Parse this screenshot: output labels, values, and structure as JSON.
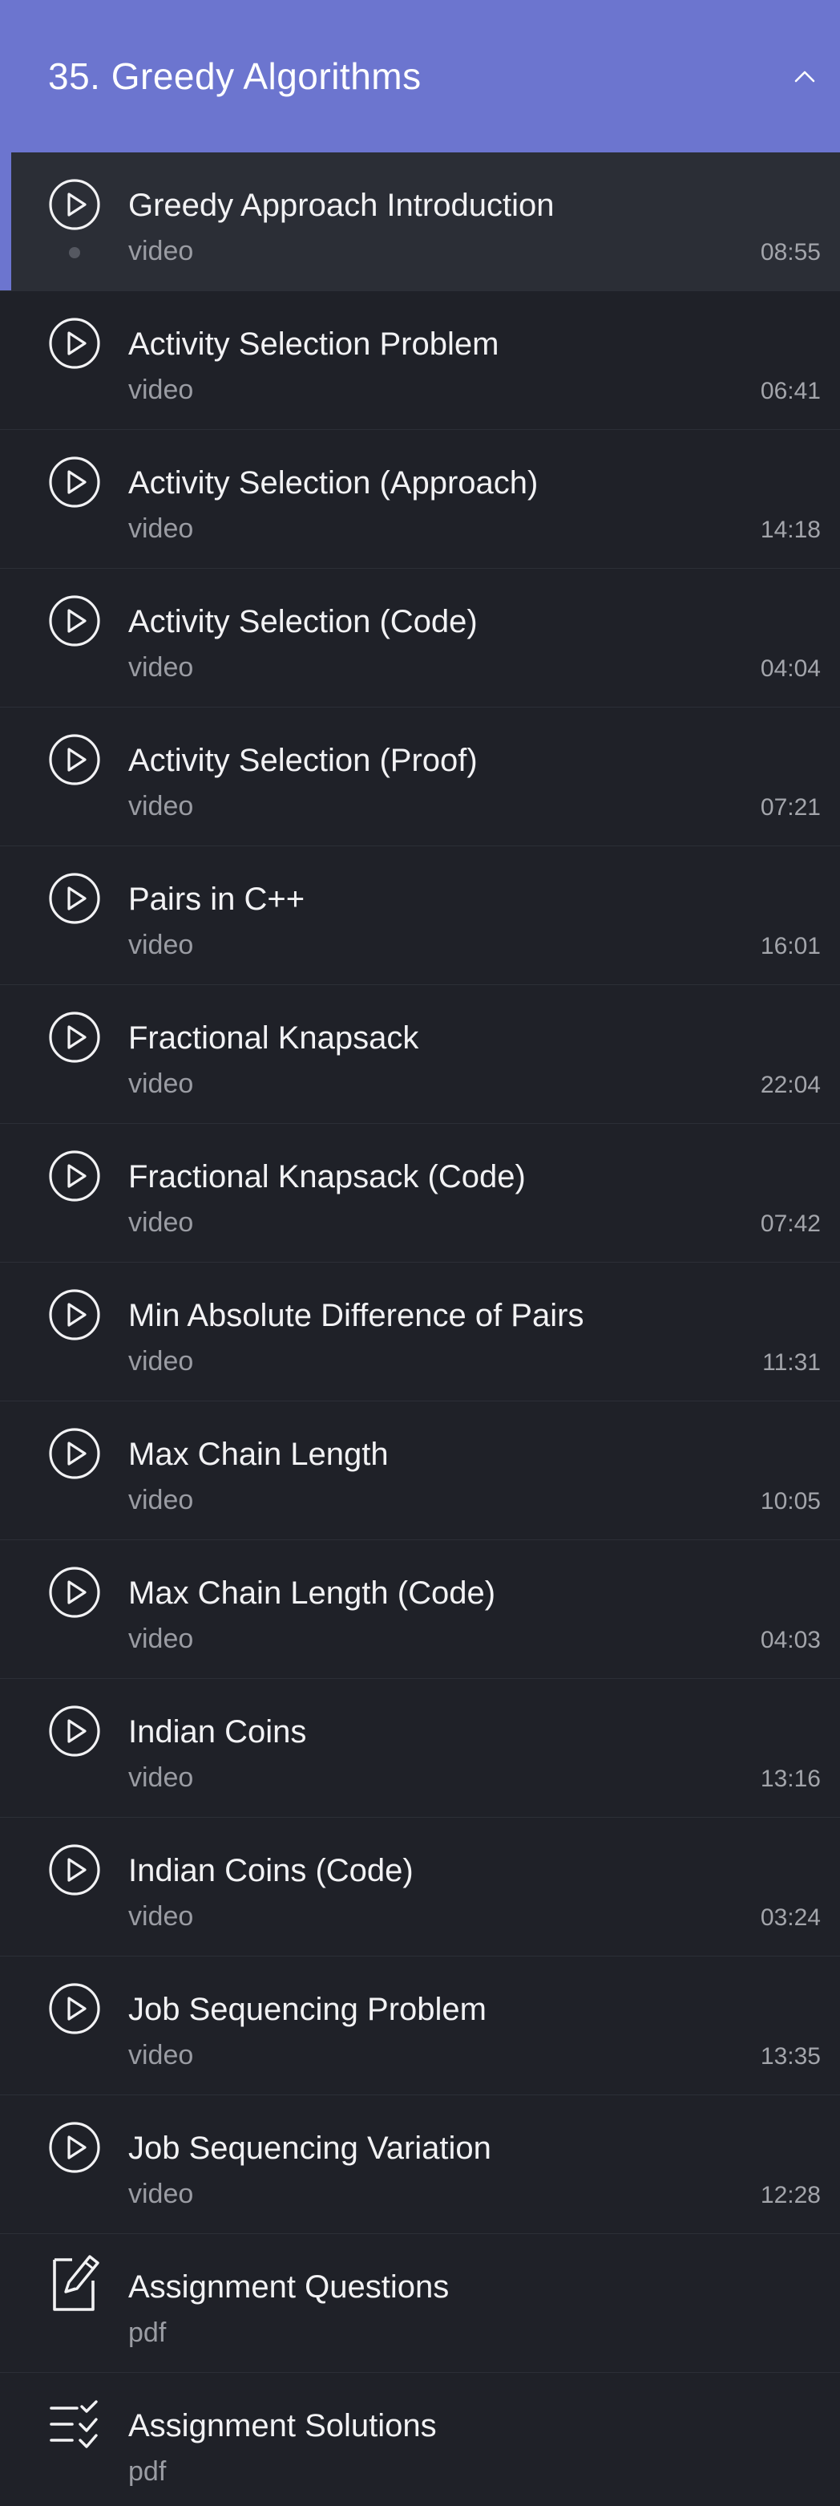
{
  "section": {
    "title": "35. Greedy Algorithms",
    "collapse_icon": "chevron-up-icon"
  },
  "items": [
    {
      "title": "Greedy Approach Introduction",
      "type": "video",
      "duration": "08:55",
      "icon": "play-circle-icon",
      "active": true
    },
    {
      "title": "Activity Selection Problem",
      "type": "video",
      "duration": "06:41",
      "icon": "play-circle-icon"
    },
    {
      "title": "Activity Selection (Approach)",
      "type": "video",
      "duration": "14:18",
      "icon": "play-circle-icon"
    },
    {
      "title": "Activity Selection (Code)",
      "type": "video",
      "duration": "04:04",
      "icon": "play-circle-icon"
    },
    {
      "title": "Activity Selection (Proof)",
      "type": "video",
      "duration": "07:21",
      "icon": "play-circle-icon"
    },
    {
      "title": "Pairs in C++",
      "type": "video",
      "duration": "16:01",
      "icon": "play-circle-icon"
    },
    {
      "title": "Fractional Knapsack",
      "type": "video",
      "duration": "22:04",
      "icon": "play-circle-icon"
    },
    {
      "title": "Fractional Knapsack (Code)",
      "type": "video",
      "duration": "07:42",
      "icon": "play-circle-icon"
    },
    {
      "title": "Min Absolute Difference of Pairs",
      "type": "video",
      "duration": "11:31",
      "icon": "play-circle-icon"
    },
    {
      "title": "Max Chain Length",
      "type": "video",
      "duration": "10:05",
      "icon": "play-circle-icon"
    },
    {
      "title": "Max Chain Length (Code)",
      "type": "video",
      "duration": "04:03",
      "icon": "play-circle-icon"
    },
    {
      "title": "Indian Coins",
      "type": "video",
      "duration": "13:16",
      "icon": "play-circle-icon"
    },
    {
      "title": "Indian Coins (Code)",
      "type": "video",
      "duration": "03:24",
      "icon": "play-circle-icon"
    },
    {
      "title": "Job Sequencing Problem",
      "type": "video",
      "duration": "13:35",
      "icon": "play-circle-icon"
    },
    {
      "title": "Job Sequencing Variation",
      "type": "video",
      "duration": "12:28",
      "icon": "play-circle-icon"
    },
    {
      "title": "Assignment Questions",
      "type": "pdf",
      "duration": "",
      "icon": "edit-document-icon"
    },
    {
      "title": "Assignment Solutions",
      "type": "pdf",
      "duration": "",
      "icon": "checklist-icon"
    }
  ],
  "colors": {
    "accent": "#6c75cf",
    "background": "#1f2128",
    "active_background": "#2b2e36",
    "text_primary": "#f2f2f4",
    "text_secondary": "#9a9ca3"
  }
}
